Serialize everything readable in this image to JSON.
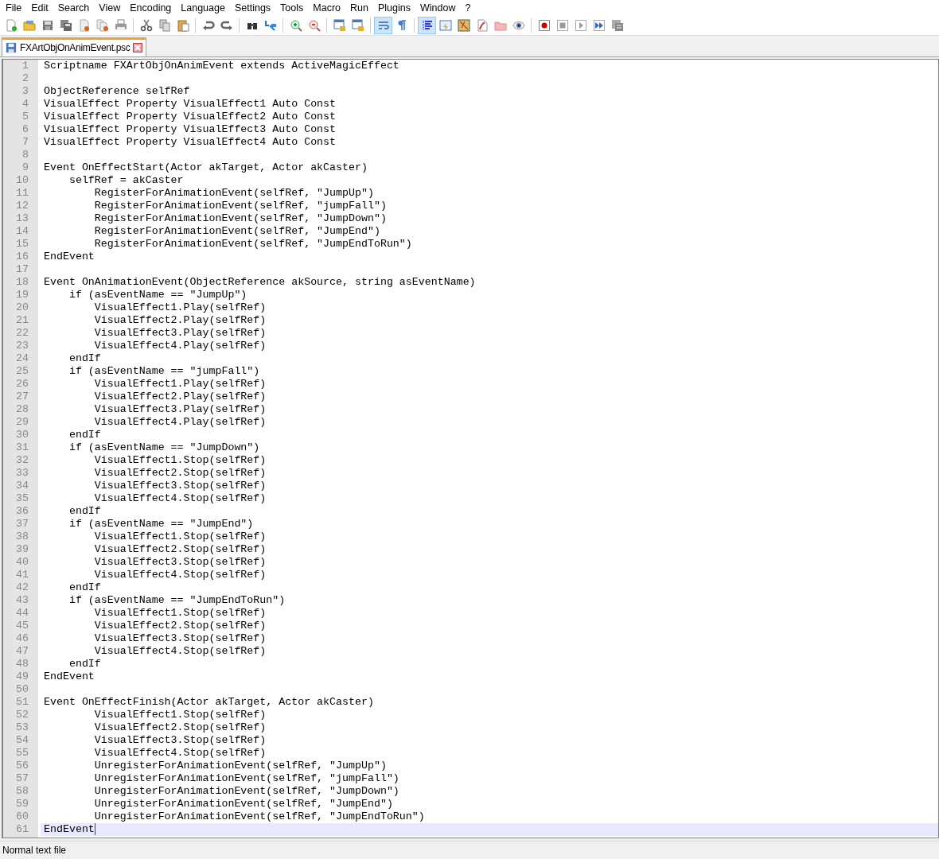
{
  "menu": [
    "File",
    "Edit",
    "Search",
    "View",
    "Encoding",
    "Language",
    "Settings",
    "Tools",
    "Macro",
    "Run",
    "Plugins",
    "Window",
    "?"
  ],
  "toolbar_toggles": {
    "word_wrap": true,
    "show_all_characters": false,
    "indent_guide": true
  },
  "tabs": [
    {
      "title": "FXArtObjOnAnimEvent.psc",
      "selected": true
    }
  ],
  "lines": [
    {
      "number": "1",
      "text": "Scriptname FXArtObjOnAnimEvent extends ActiveMagicEffect",
      "current": false
    },
    {
      "number": "2",
      "current": false
    },
    {
      "number": "3",
      "text": "ObjectReference selfRef",
      "current": false
    },
    {
      "number": "4",
      "text": "VisualEffect Property VisualEffect1 Auto Const",
      "current": false
    },
    {
      "number": "5",
      "text": "VisualEffect Property VisualEffect2 Auto Const",
      "current": false
    },
    {
      "number": "6",
      "text": "VisualEffect Property VisualEffect3 Auto Const",
      "current": false
    },
    {
      "number": "7",
      "text": "VisualEffect Property VisualEffect4 Auto Const",
      "current": false
    },
    {
      "number": "8",
      "current": false
    },
    {
      "number": "9",
      "text": "Event OnEffectStart(Actor akTarget, Actor akCaster)",
      "current": false
    },
    {
      "number": "10",
      "text": "    selfRef = akCaster",
      "current": false
    },
    {
      "number": "11",
      "text": "        RegisterForAnimationEvent(selfRef, \"JumpUp\")",
      "current": false
    },
    {
      "number": "12",
      "text": "        RegisterForAnimationEvent(selfRef, \"jumpFall\")",
      "current": false
    },
    {
      "number": "13",
      "text": "        RegisterForAnimationEvent(selfRef, \"JumpDown\")",
      "current": false
    },
    {
      "number": "14",
      "text": "        RegisterForAnimationEvent(selfRef, \"JumpEnd\")",
      "current": false
    },
    {
      "number": "15",
      "text": "        RegisterForAnimationEvent(selfRef, \"JumpEndToRun\")",
      "current": false
    },
    {
      "number": "16",
      "text": "EndEvent",
      "current": false
    },
    {
      "number": "17",
      "current": false
    },
    {
      "number": "18",
      "text": "Event OnAnimationEvent(ObjectReference akSource, string asEventName)",
      "current": false
    },
    {
      "number": "19",
      "text": "    if (asEventName == \"JumpUp\")",
      "current": false
    },
    {
      "number": "20",
      "text": "        VisualEffect1.Play(selfRef)",
      "current": false
    },
    {
      "number": "21",
      "text": "        VisualEffect2.Play(selfRef)",
      "current": false
    },
    {
      "number": "22",
      "text": "        VisualEffect3.Play(selfRef)",
      "current": false
    },
    {
      "number": "23",
      "text": "        VisualEffect4.Play(selfRef)",
      "current": false
    },
    {
      "number": "24",
      "text": "    endIf",
      "current": false
    },
    {
      "number": "25",
      "text": "    if (asEventName == \"jumpFall\")",
      "current": false
    },
    {
      "number": "26",
      "text": "        VisualEffect1.Play(selfRef)",
      "current": false
    },
    {
      "number": "27",
      "text": "        VisualEffect2.Play(selfRef)",
      "current": false
    },
    {
      "number": "28",
      "text": "        VisualEffect3.Play(selfRef)",
      "current": false
    },
    {
      "number": "29",
      "text": "        VisualEffect4.Play(selfRef)",
      "current": false
    },
    {
      "number": "30",
      "text": "    endIf",
      "current": false
    },
    {
      "number": "31",
      "text": "    if (asEventName == \"JumpDown\")",
      "current": false
    },
    {
      "number": "32",
      "text": "        VisualEffect1.Stop(selfRef)",
      "current": false
    },
    {
      "number": "33",
      "text": "        VisualEffect2.Stop(selfRef)",
      "current": false
    },
    {
      "number": "34",
      "text": "        VisualEffect3.Stop(selfRef)",
      "current": false
    },
    {
      "number": "35",
      "text": "        VisualEffect4.Stop(selfRef)",
      "current": false
    },
    {
      "number": "36",
      "text": "    endIf",
      "current": false
    },
    {
      "number": "37",
      "text": "    if (asEventName == \"JumpEnd\")",
      "current": false
    },
    {
      "number": "38",
      "text": "        VisualEffect1.Stop(selfRef)",
      "current": false
    },
    {
      "number": "39",
      "text": "        VisualEffect2.Stop(selfRef)",
      "current": false
    },
    {
      "number": "40",
      "text": "        VisualEffect3.Stop(selfRef)",
      "current": false
    },
    {
      "number": "41",
      "text": "        VisualEffect4.Stop(selfRef)",
      "current": false
    },
    {
      "number": "42",
      "text": "    endIf",
      "current": false
    },
    {
      "number": "43",
      "text": "    if (asEventName == \"JumpEndToRun\")",
      "current": false
    },
    {
      "number": "44",
      "text": "        VisualEffect1.Stop(selfRef)",
      "current": false
    },
    {
      "number": "45",
      "text": "        VisualEffect2.Stop(selfRef)",
      "current": false
    },
    {
      "number": "46",
      "text": "        VisualEffect3.Stop(selfRef)",
      "current": false
    },
    {
      "number": "47",
      "text": "        VisualEffect4.Stop(selfRef)",
      "current": false
    },
    {
      "number": "48",
      "text": "    endIf",
      "current": false
    },
    {
      "number": "49",
      "text": "EndEvent",
      "current": false
    },
    {
      "number": "50",
      "current": false
    },
    {
      "number": "51",
      "text": "Event OnEffectFinish(Actor akTarget, Actor akCaster)",
      "current": false
    },
    {
      "number": "52",
      "text": "        VisualEffect1.Stop(selfRef)",
      "current": false
    },
    {
      "number": "53",
      "text": "        VisualEffect2.Stop(selfRef)",
      "current": false
    },
    {
      "number": "54",
      "text": "        VisualEffect3.Stop(selfRef)",
      "current": false
    },
    {
      "number": "55",
      "text": "        VisualEffect4.Stop(selfRef)",
      "current": false
    },
    {
      "number": "56",
      "text": "        UnregisterForAnimationEvent(selfRef, \"JumpUp\")",
      "current": false
    },
    {
      "number": "57",
      "text": "        UnregisterForAnimationEvent(selfRef, \"jumpFall\")",
      "current": false
    },
    {
      "number": "58",
      "text": "        UnregisterForAnimationEvent(selfRef, \"JumpDown\")",
      "current": false
    },
    {
      "number": "59",
      "text": "        UnregisterForAnimationEvent(selfRef, \"JumpEnd\")",
      "current": false
    },
    {
      "number": "60",
      "text": "        UnregisterForAnimationEvent(selfRef, \"JumpEndToRun\")",
      "current": false
    },
    {
      "number": "61",
      "text": "EndEvent",
      "current": true
    }
  ],
  "status_bar": {
    "file_type": "Normal text file"
  }
}
